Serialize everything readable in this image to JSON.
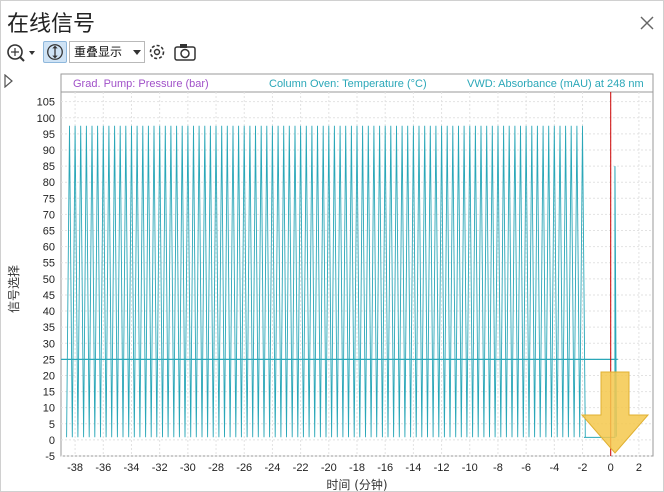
{
  "window": {
    "title": "在线信号"
  },
  "toolbar": {
    "display_mode": "重叠显示"
  },
  "chart_data": {
    "type": "line",
    "legend": [
      {
        "name": "Grad. Pump: Pressure (bar)",
        "color": "#a050c8"
      },
      {
        "name": "Column Oven: Temperature (°C)",
        "color": "#2aa7b8"
      },
      {
        "name": "VWD: Absorbance (mAU) at 248 nm",
        "color": "#2aa7b8"
      }
    ],
    "xlabel": "时间 (分钟)",
    "ylabel": "信号选择",
    "xlim": [
      -39,
      3
    ],
    "ylim": [
      -5,
      108
    ],
    "xticks": [
      "-38",
      "-36",
      "-34",
      "-32",
      "-30",
      "-28",
      "-26",
      "-24",
      "-22",
      "-20",
      "-18",
      "-16",
      "-14",
      "-12",
      "-10",
      "-8",
      "-6",
      "-4",
      "-2",
      "0",
      "2"
    ],
    "yticks": [
      "105",
      "100",
      "95",
      "90",
      "85",
      "80",
      "75",
      "70",
      "65",
      "60",
      "55",
      "50",
      "45",
      "40",
      "35",
      "30",
      "25",
      "20",
      "15",
      "10",
      "5",
      "0",
      "-5"
    ],
    "grid": true,
    "current_time": 0,
    "series": [
      {
        "name": "Column Oven: Temperature (°C)",
        "values_description": "flat",
        "value": 25,
        "x_range": [
          -39,
          0.5
        ]
      },
      {
        "name": "VWD: Absorbance (mAU) at 248 nm",
        "oscillation": {
          "min": 0.8,
          "max": 97.5,
          "period_min": 0.4,
          "x_start": -38.6,
          "x_end": -1.9
        }
      }
    ]
  },
  "colors": {
    "accent_line": "#2aa7b8",
    "cursor_line": "#cc0000",
    "arrow": "#f5c84c"
  }
}
